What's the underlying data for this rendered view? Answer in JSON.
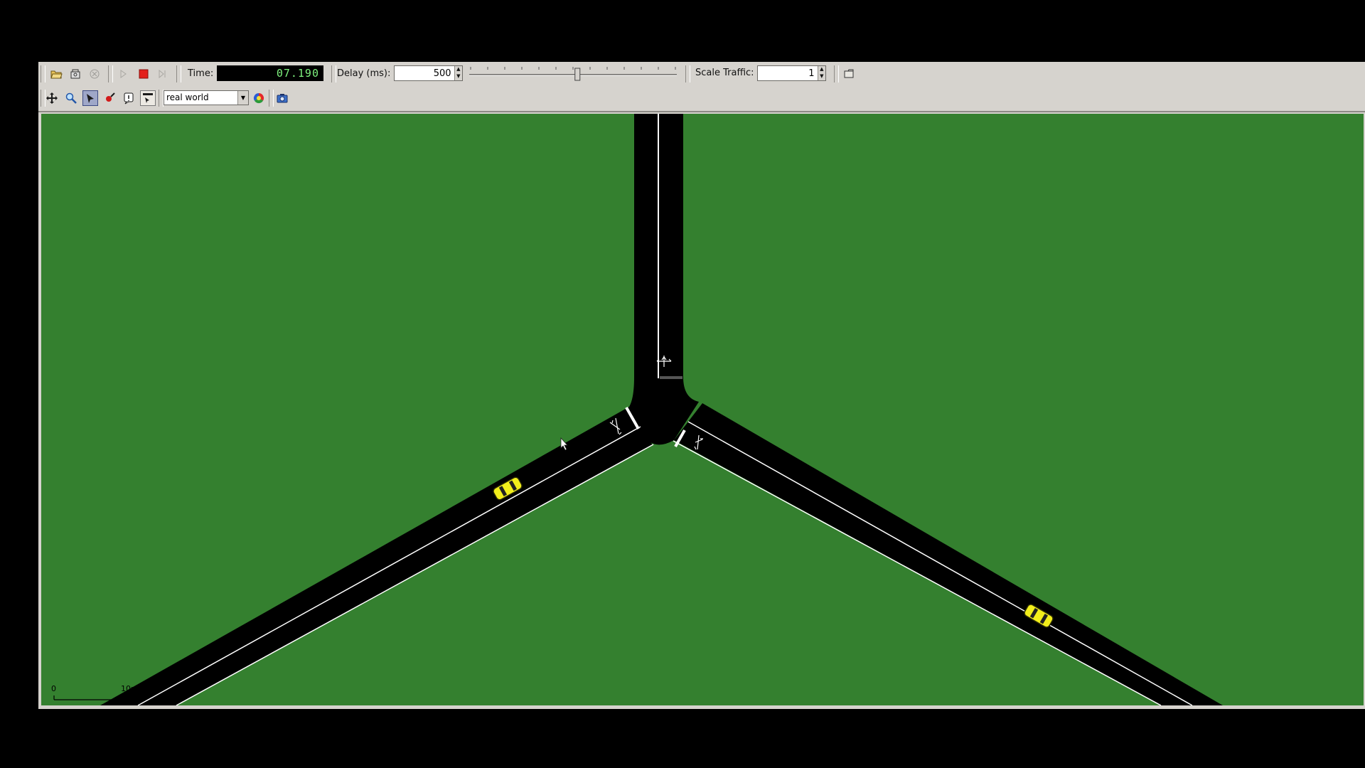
{
  "toolbar": {
    "time_label": "Time:",
    "time_value": "07.190",
    "delay_label": "Delay (ms):",
    "delay_value": "500",
    "delay_slider_fraction": 0.52,
    "scale_label": "Scale Traffic:",
    "scale_value": "1",
    "icons": [
      "open-icon",
      "reload-icon",
      "close-icon",
      "run-icon",
      "stop-icon",
      "step-icon",
      "breakpoint-icon"
    ]
  },
  "viewbar": {
    "scheme_value": "real world",
    "icons": [
      "recenter-icon",
      "locate-icon",
      "select-icon",
      "edit-icon",
      "breakpoints-icon",
      "menu-icon",
      "color-icon",
      "screenshot-icon"
    ]
  },
  "canvas": {
    "background_color": "#34802f",
    "road_color": "#000000",
    "vehicle_color": "#f2ee1b",
    "scale_bar": {
      "start_label": "0",
      "end_label": "10m"
    }
  }
}
